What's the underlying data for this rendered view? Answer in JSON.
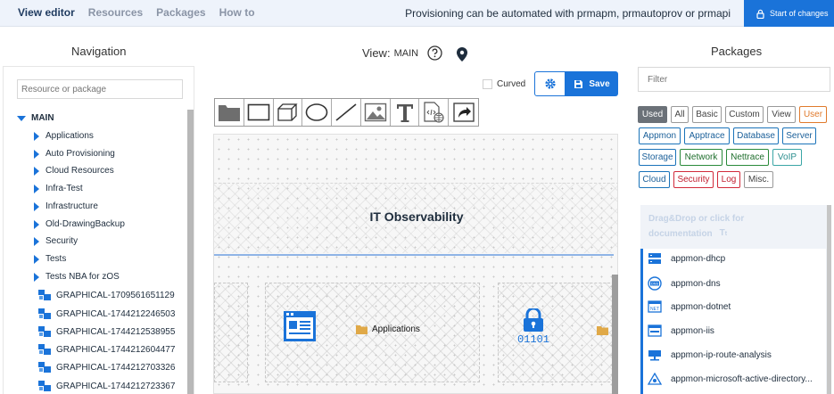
{
  "tabs": [
    {
      "label": "View editor"
    },
    {
      "label": "Resources"
    },
    {
      "label": "Packages"
    },
    {
      "label": "How to"
    }
  ],
  "top_message": "Provisioning can be automated with prmapm, prmautoprov or prmapi",
  "start_changes_label": "Start of changes",
  "navigation": {
    "title": "Navigation",
    "search_placeholder": "Resource or package",
    "root": "MAIN",
    "folders": [
      "Applications",
      "Auto Provisioning",
      "Cloud Resources",
      "Infra-Test",
      "Infrastructure",
      "Old-DrawingBackup",
      "Security",
      "Tests",
      "Tests NBA for zOS"
    ],
    "graphicals": [
      "GRAPHICAL-1709561651129",
      "GRAPHICAL-1744212246503",
      "GRAPHICAL-1744212538955",
      "GRAPHICAL-1744212604477",
      "GRAPHICAL-1744212703326",
      "GRAPHICAL-1744212723367"
    ]
  },
  "view": {
    "label": "View:",
    "name": "MAIN"
  },
  "curved_label": "Curved",
  "save_label": "Save",
  "tools": [
    "folder-tool",
    "rectangle-tool",
    "cube-tool",
    "ellipse-tool",
    "line-tool",
    "image-tool",
    "text-tool",
    "html-tool",
    "link-tool"
  ],
  "canvas": {
    "band_title": "IT Observability",
    "cell_label": "Applications",
    "code_text": "01101"
  },
  "packages": {
    "title": "Packages",
    "filter_placeholder": "Filter",
    "chips_row1": [
      "Used",
      "All",
      "Basic",
      "Custom",
      "View",
      "User"
    ],
    "chips_row2": [
      "Appmon",
      "Apptrace",
      "Database",
      "Server"
    ],
    "chips_row3": [
      "Storage",
      "Network",
      "Nettrace",
      "VoIP"
    ],
    "chips_row4": [
      "Cloud",
      "Security",
      "Log",
      "Misc."
    ],
    "dnd_line1": "Drag&Drop or click for",
    "dnd_line2": "documentation",
    "items": [
      "appmon-dhcp",
      "appmon-dns",
      "appmon-dotnet",
      "appmon-iis",
      "appmon-ip-route-analysis",
      "appmon-microsoft-active-directory..."
    ]
  },
  "colors": {
    "accent": "#1a73d9",
    "topbar": "#eef3fb"
  }
}
